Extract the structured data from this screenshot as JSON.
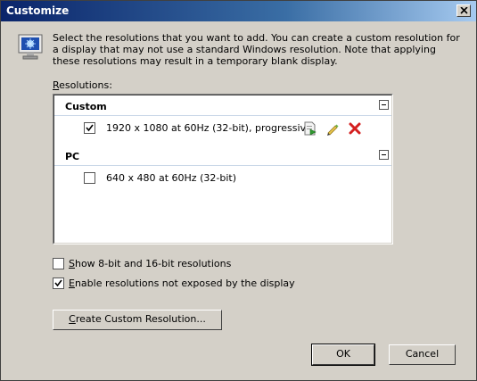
{
  "window": {
    "title": "Customize"
  },
  "description": "Select the resolutions that you want to add. You can create a custom resolution for a display that may not use a standard Windows resolution. Note that applying these resolutions may result in a temporary blank display.",
  "resolutions_label": "Resolutions:",
  "groups": [
    {
      "title": "Custom",
      "items": [
        {
          "label": "1920 x 1080 at 60Hz (32-bit), progressive",
          "checked": true
        }
      ]
    },
    {
      "title": "PC",
      "items": [
        {
          "label": "640 x 480 at 60Hz (32-bit)",
          "checked": false
        }
      ]
    }
  ],
  "options": [
    {
      "label": "Show 8-bit and 16-bit resolutions",
      "checked": false
    },
    {
      "label": "Enable resolutions not exposed by the display",
      "checked": true
    }
  ],
  "buttons": {
    "create_custom": "Create Custom Resolution...",
    "ok": "OK",
    "cancel": "Cancel"
  },
  "icons": {
    "title_close": "close-icon",
    "monitor": "monitor-icon",
    "test": "test-resolution-icon",
    "edit": "edit-pencil-icon",
    "delete": "delete-x-icon",
    "delete_color": "#d42020"
  }
}
